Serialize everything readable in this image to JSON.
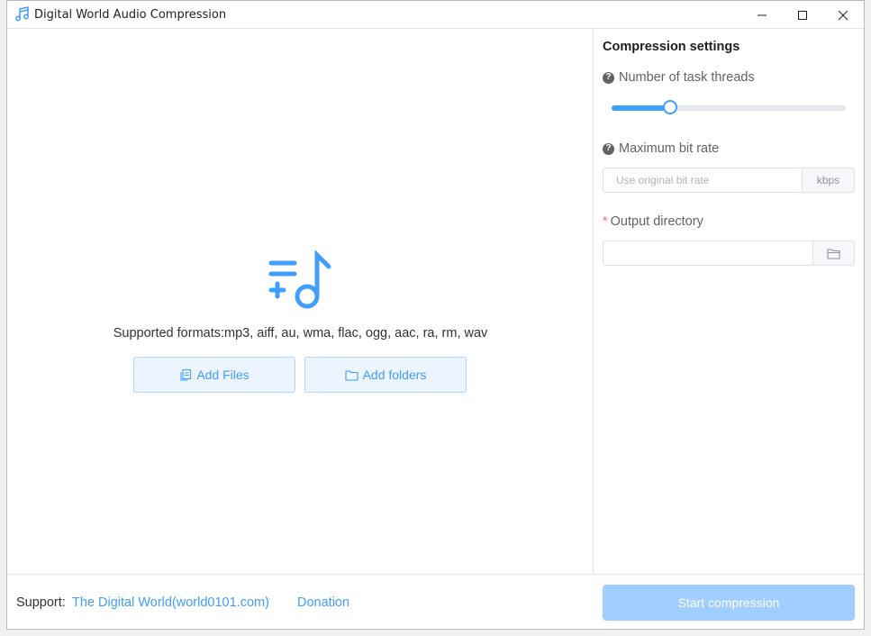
{
  "window": {
    "title": "Digital World Audio Compression"
  },
  "main": {
    "supported_formats": "Supported formats:mp3, aiff, au, wma, flac, ogg, aac, ra, rm, wav",
    "add_files_label": "Add Files",
    "add_folders_label": "Add folders"
  },
  "settings": {
    "title": "Compression settings",
    "threads_label": "Number of task threads",
    "threads_level": 0.25,
    "bitrate_label": "Maximum bit rate",
    "bitrate_placeholder": "Use original bit rate",
    "bitrate_unit": "kbps",
    "output_label": "Output directory",
    "output_required_mark": "*",
    "output_value": ""
  },
  "footer": {
    "support_label": "Support:",
    "site_link": "The Digital World(world0101.com)",
    "donation_link": "Donation",
    "start_label": "Start compression"
  },
  "colors": {
    "accent": "#409eff",
    "accent_disabled": "#a0cfff",
    "required": "#f56c6c"
  },
  "icons": {
    "app": "music-note-icon",
    "drop": "add-music-icon",
    "files": "files-icon",
    "folder": "folder-icon",
    "help": "question-circle-icon"
  }
}
